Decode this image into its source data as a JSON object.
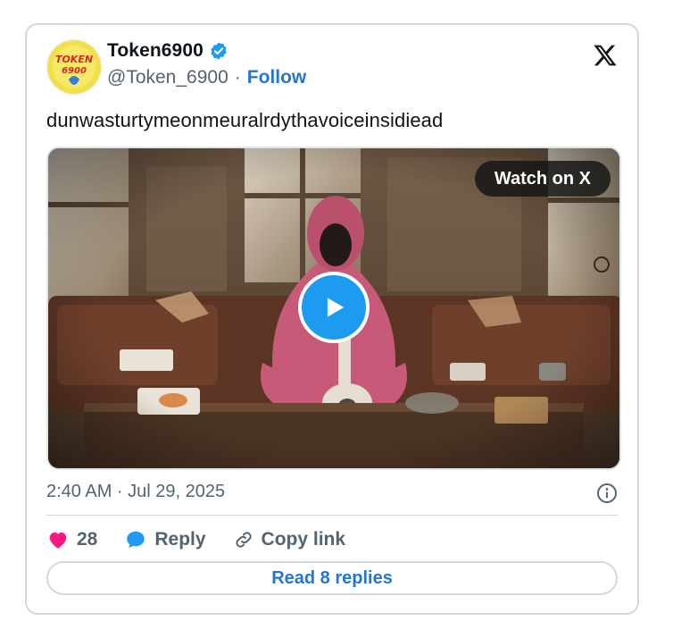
{
  "author": {
    "display_name": "Token6900",
    "handle": "@Token_6900",
    "separator": "·",
    "follow_label": "Follow",
    "avatar_text": "TOKEN 6900",
    "verified": true
  },
  "tweet": {
    "text": "dunwasturtymeonmeuralrdythavoiceinsidiead",
    "timestamp": "2:40 AM · Jul 29, 2025"
  },
  "media": {
    "watch_label": "Watch on X"
  },
  "actions": {
    "like_count": "28",
    "reply_label": "Reply",
    "copy_link_label": "Copy link",
    "read_replies_label": "Read 8 replies"
  },
  "icons": {
    "verified": "verified-badge-icon",
    "x_logo": "x-logo-icon",
    "play": "play-icon",
    "info": "info-icon",
    "heart": "heart-icon",
    "reply": "reply-bubble-icon",
    "link": "link-icon"
  },
  "colors": {
    "accent": "#1d9bf0",
    "link_blue": "#2477d0",
    "heart": "#f91880",
    "muted": "#536471",
    "border": "#cfd9de"
  }
}
